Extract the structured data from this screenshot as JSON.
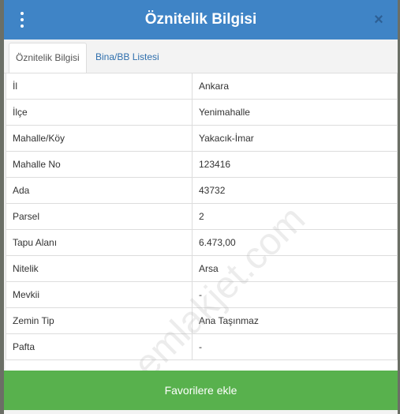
{
  "header": {
    "title": "Öznitelik Bilgisi",
    "close_glyph": "×"
  },
  "tabs": [
    {
      "label": "Öznitelik Bilgisi",
      "active": true
    },
    {
      "label": "Bina/BB Listesi",
      "active": false
    }
  ],
  "rows": [
    {
      "key": "İl",
      "value": "Ankara"
    },
    {
      "key": "İlçe",
      "value": "Yenimahalle"
    },
    {
      "key": "Mahalle/Köy",
      "value": "Yakacık-İmar"
    },
    {
      "key": "Mahalle No",
      "value": "123416"
    },
    {
      "key": "Ada",
      "value": "43732"
    },
    {
      "key": "Parsel",
      "value": "2"
    },
    {
      "key": "Tapu Alanı",
      "value": "6.473,00"
    },
    {
      "key": "Nitelik",
      "value": "Arsa"
    },
    {
      "key": "Mevkii",
      "value": "-"
    },
    {
      "key": "Zemin Tip",
      "value": "Ana Taşınmaz"
    },
    {
      "key": "Pafta",
      "value": "-"
    }
  ],
  "footer": {
    "button_label": "Favorilere ekle"
  },
  "watermark": "emlakjet.com",
  "colors": {
    "header": "#3f84c6",
    "footer": "#58b14d",
    "tab_link": "#2f6fad"
  },
  "icons": {
    "menu": "kebab-menu-icon",
    "close": "close-icon"
  }
}
